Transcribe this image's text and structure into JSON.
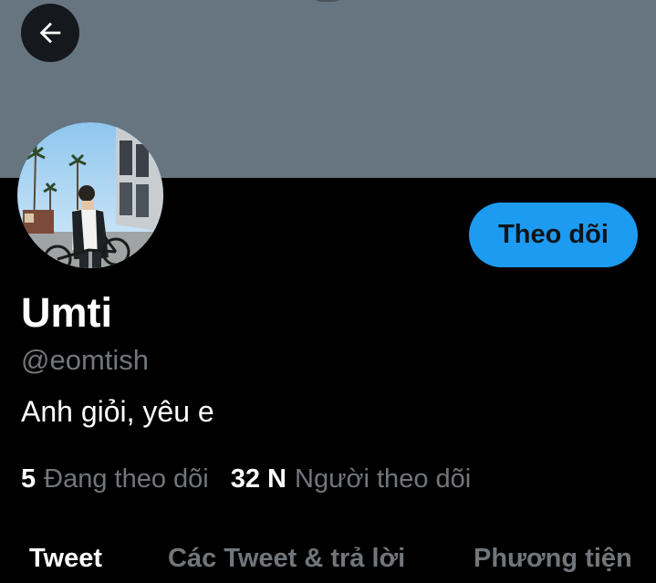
{
  "header": {
    "back_icon": "arrow-left-icon",
    "banner_color": "#66757f"
  },
  "profile": {
    "display_name": "Umti",
    "handle": "@eomtish",
    "bio": "Anh giỏi, yêu e",
    "follow_label": "Theo dõi",
    "avatar_icon": "profile-photo"
  },
  "stats": {
    "following_count": "5",
    "following_label": "Đang theo dõi",
    "followers_count": "32 N",
    "followers_label": "Người theo dõi"
  },
  "tabs": [
    {
      "label": "Tweet",
      "active": true
    },
    {
      "label": "Các Tweet & trả lời",
      "active": false
    },
    {
      "label": "Phương tiện",
      "active": false
    }
  ],
  "colors": {
    "accent": "#1d9bf0",
    "background": "#000000",
    "secondary_text": "#71767b",
    "primary_text": "#ffffff"
  }
}
